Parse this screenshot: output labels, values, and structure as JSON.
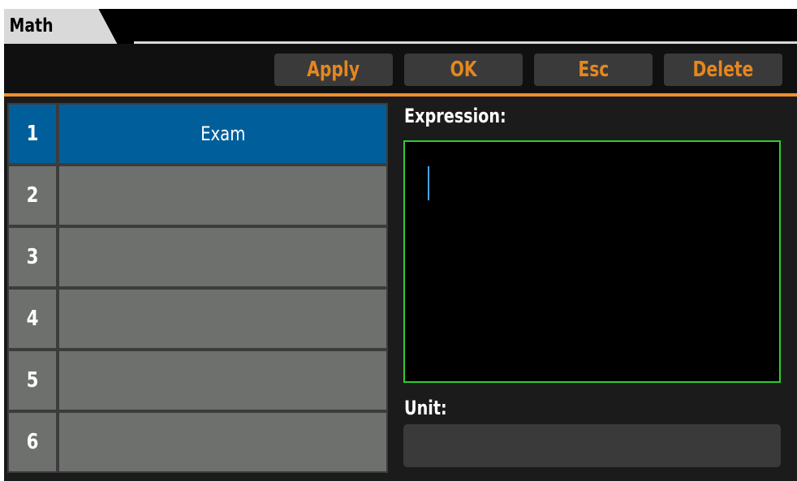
{
  "window": {
    "title": "Math"
  },
  "toolbar": {
    "buttons": [
      {
        "label": "Apply"
      },
      {
        "label": "OK"
      },
      {
        "label": "Esc"
      },
      {
        "label": "Delete"
      }
    ]
  },
  "list": {
    "rows": [
      {
        "number": "1",
        "name": "Exam",
        "selected": true
      },
      {
        "number": "2",
        "name": "",
        "selected": false
      },
      {
        "number": "3",
        "name": "",
        "selected": false
      },
      {
        "number": "4",
        "name": "",
        "selected": false
      },
      {
        "number": "5",
        "name": "",
        "selected": false
      },
      {
        "number": "6",
        "name": "",
        "selected": false
      }
    ]
  },
  "expression": {
    "label": "Expression:",
    "value": ""
  },
  "unit": {
    "label": "Unit:",
    "value": ""
  },
  "colors": {
    "accent": "#f0902a",
    "button_text": "#e5871f",
    "selected_row": "#005f9b",
    "row_bg": "#6e706d",
    "expression_border": "#2ecc2e",
    "cursor": "#4aa3df"
  }
}
